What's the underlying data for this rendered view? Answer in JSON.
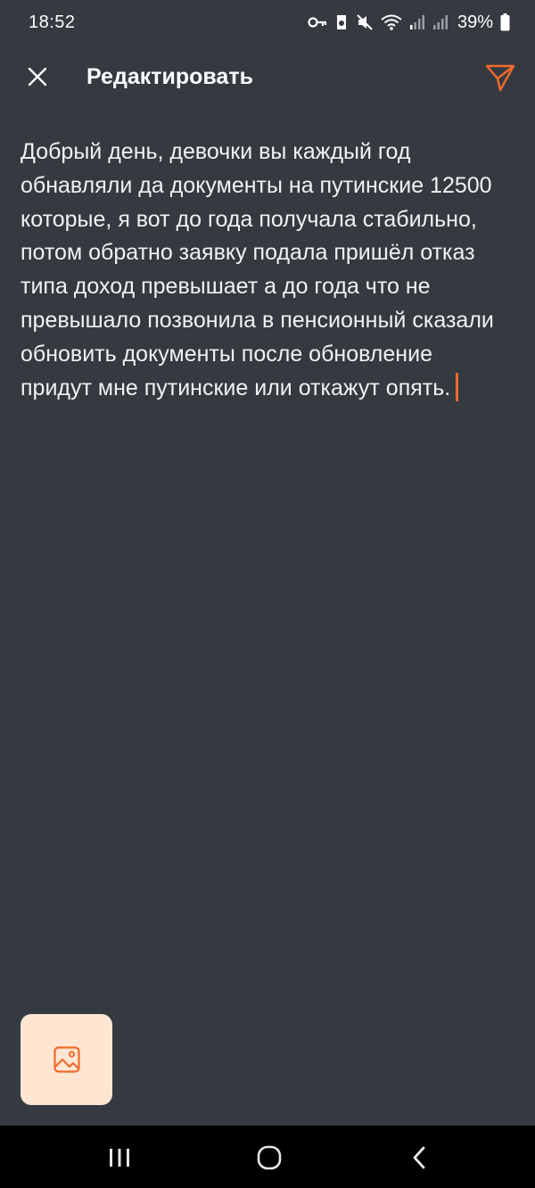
{
  "status_bar": {
    "time": "18:52",
    "battery": "39%",
    "icons": [
      "key-icon",
      "notification-icon",
      "mute-icon",
      "wifi-icon",
      "signal-icon",
      "signal-icon-2",
      "battery-icon"
    ]
  },
  "app_bar": {
    "title": "Редактировать",
    "close_icon": "close-icon",
    "send_icon": "send-icon"
  },
  "editor": {
    "text": "Добрый день, девочки вы каждый год обнавляли да документы на путинские 12500 которые, я вот до года получала стабильно, потом обратно заявку подала пришёл отказ типа доход превышает а до года что не превышало позвонила в пенсионный сказали обновить документы после обновление придут мне путинские или откажут опять."
  },
  "toolbar": {
    "image_icon": "image-icon"
  },
  "nav": {
    "recents_icon": "recents-icon",
    "home_icon": "home-icon",
    "back_icon": "back-icon"
  },
  "colors": {
    "background": "#353a41",
    "accent": "#f06a2a",
    "image_button_bg": "#ffe6d3"
  }
}
